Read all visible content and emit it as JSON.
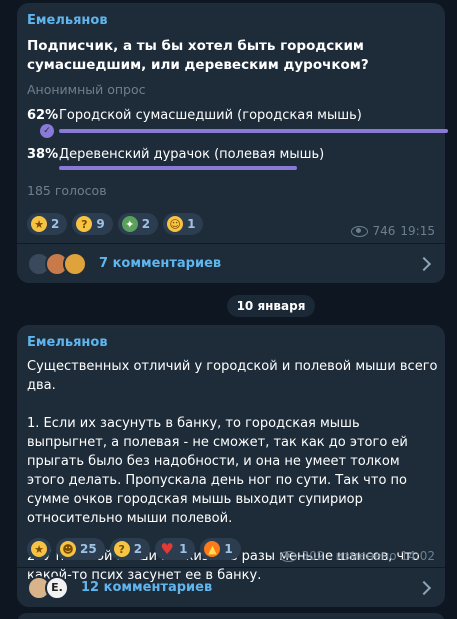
{
  "post1": {
    "author": "Емельянов",
    "question": "Подписчик, а ты бы хотел быть городским сумасшедшим, или деревеским дурочком?",
    "poll_type": "Анонимный опрос",
    "options": [
      {
        "percent": "62%",
        "text": "Городской сумасшедший (городская мышь)",
        "share": 0.62,
        "chosen": true
      },
      {
        "percent": "38%",
        "text": "Деревенский дурачок (полевая мышь)",
        "share": 0.38,
        "chosen": false
      }
    ],
    "votes": "185 голосов",
    "reactions": [
      {
        "icon": "star-icon",
        "count": "2"
      },
      {
        "icon": "thinking-face-icon",
        "count": "9"
      },
      {
        "icon": "champagne-icon",
        "count": "2"
      },
      {
        "icon": "zany-face-icon",
        "count": "1"
      }
    ],
    "views": "746",
    "time": "19:15",
    "comments": "7 комментариев"
  },
  "date_separator": "10 января",
  "post2": {
    "author": "Емельянов",
    "paragraphs": [
      "Существенных отличий у городской и полевой мыши всего два.",
      "1. Если их засунуть в банку, то городская мышь выпрыгнет, а полевая - не сможет, так как до этого ей прыгать было без надобности, и она не умеет толком этого делать. Пропускала день ног по сути. Так что по сумме очков городская мышь выходит супириор относительно мыши полевой.",
      "2. У полевой мыши по жизни в разы меньше шансов, что какой-то псих засунет ее в банку."
    ],
    "reactions": [
      {
        "icon": "star-icon",
        "count": ""
      },
      {
        "icon": "grinning-face-icon",
        "count": "25"
      },
      {
        "icon": "thinking-face-icon",
        "count": "2"
      },
      {
        "icon": "heart-icon",
        "count": "1"
      },
      {
        "icon": "fire-icon",
        "count": "1"
      }
    ],
    "views": "302",
    "time": "изменено 14:02",
    "avatar_letter": "E.",
    "comments": "12 комментариев"
  },
  "colors": {
    "background": "#0e1621",
    "bubble": "#1e2c3a",
    "accent": "#5fb6ee",
    "poll_bar": "#8a7ad8",
    "muted": "#6d7f8f"
  }
}
